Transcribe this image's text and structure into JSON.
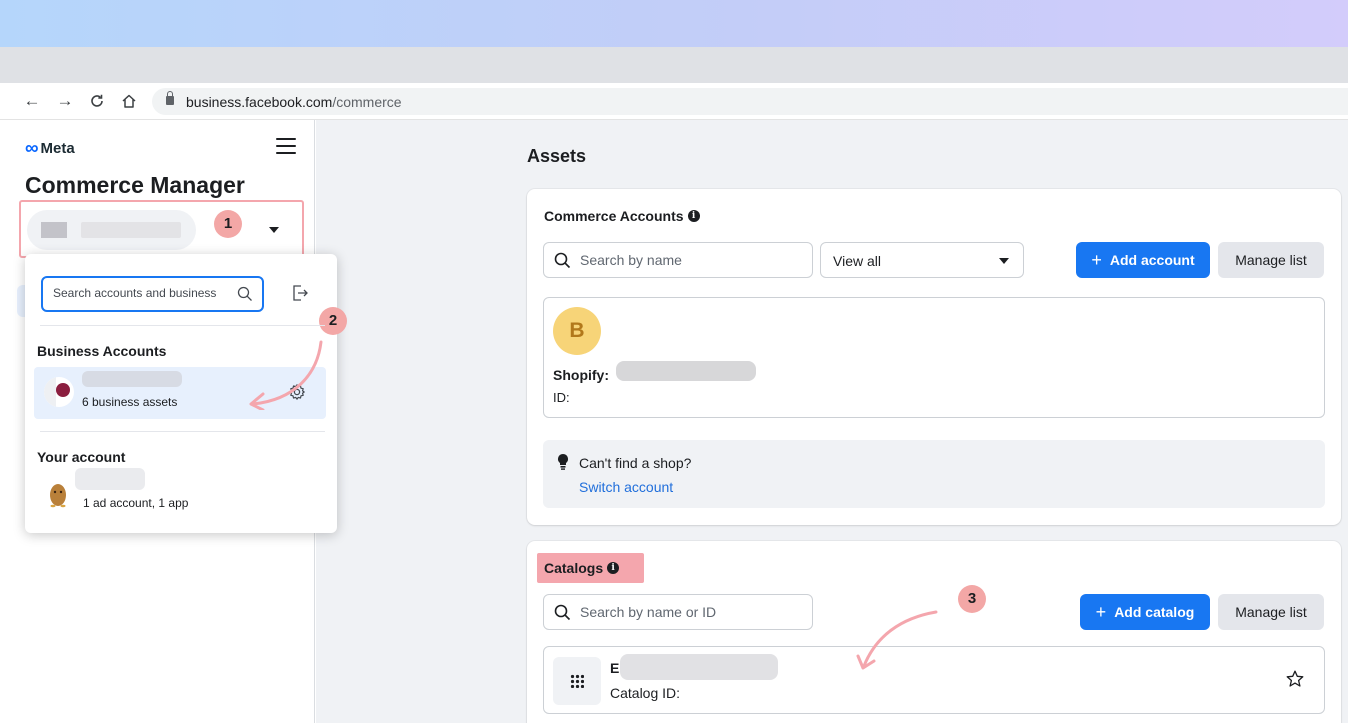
{
  "browser": {
    "url_domain": "business.facebook.com",
    "url_path": "/commerce",
    "back_icon": "arrow-left-icon",
    "forward_icon": "arrow-right-icon",
    "reload_icon": "reload-icon",
    "home_icon": "home-icon"
  },
  "sidebar": {
    "brand": "Meta",
    "title": "Commerce Manager",
    "selector_badge": "1",
    "dropdown": {
      "search_placeholder": "Search accounts and business",
      "badge": "2",
      "business_section_label": "Business Accounts",
      "business_item_sub": "6 business assets",
      "your_account_label": "Your account",
      "account_item_sub": "1 ad account, 1 app"
    }
  },
  "main": {
    "title": "Assets",
    "commerce_accounts": {
      "title": "Commerce Accounts",
      "search_placeholder": "Search by name",
      "filter_value": "View all",
      "add_button": "Add account",
      "manage_button": "Manage list",
      "shop": {
        "avatar_letter": "B",
        "name_label": "Shopify:",
        "id_label": "ID:"
      },
      "hint_text": "Can't find a shop?",
      "hint_link": "Switch account"
    },
    "catalogs": {
      "title": "Catalogs",
      "badge": "3",
      "search_placeholder": "Search by name or ID",
      "add_button": "Add catalog",
      "manage_button": "Manage list",
      "catalog_initial": "E",
      "catalog_id_label": "Catalog ID:"
    }
  },
  "colors": {
    "accent": "#1877f2",
    "highlight": "#f4a6ad",
    "badge": "#f3a7a6",
    "link": "#216fdb"
  }
}
